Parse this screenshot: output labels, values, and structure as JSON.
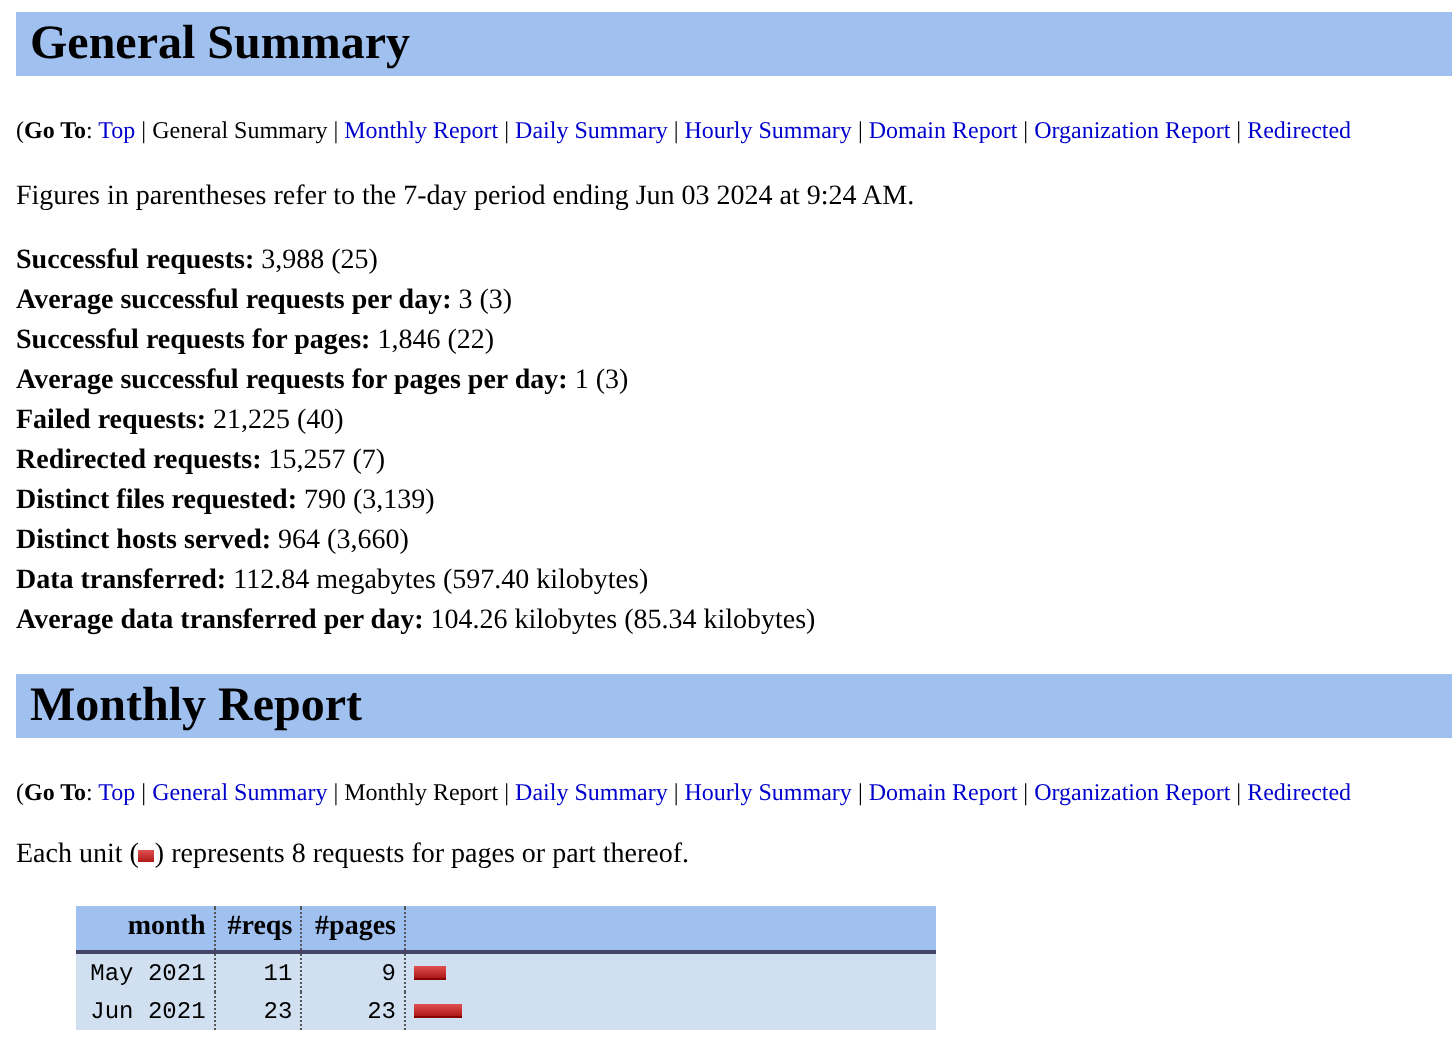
{
  "general_summary": {
    "title": "General Summary",
    "nav": {
      "label": "(**Go To**:",
      "separator": "|",
      "items": [
        {
          "text": "Top",
          "selected": false
        },
        {
          "text": "General Summary",
          "selected": true
        },
        {
          "text": "Monthly Report",
          "selected": false
        },
        {
          "text": "Daily Summary",
          "selected": false
        },
        {
          "text": "Hourly Summary",
          "selected": false
        },
        {
          "text": "Domain Report",
          "selected": false
        },
        {
          "text": "Organization Report",
          "selected": false
        },
        {
          "text": "Redirected",
          "selected": false
        }
      ]
    },
    "note": "Figures in parentheses refer to the 7-day period ending Jun 03 2024 at 9:24 AM.",
    "stats": [
      {
        "label": "Successful requests:",
        "value": "3,988 (25)"
      },
      {
        "label": "Average successful requests per day:",
        "value": "3 (3)"
      },
      {
        "label": "Successful requests for pages:",
        "value": "1,846 (22)"
      },
      {
        "label": "Average successful requests for pages per day:",
        "value": "1 (3)"
      },
      {
        "label": "Failed requests:",
        "value": "21,225 (40)"
      },
      {
        "label": "Redirected requests:",
        "value": "15,257 (7)"
      },
      {
        "label": "Distinct files requested:",
        "value": "790 (3,139)"
      },
      {
        "label": "Distinct hosts served:",
        "value": "964 (3,660)"
      },
      {
        "label": "Data transferred:",
        "value": "112.84 megabytes (597.40 kilobytes)"
      },
      {
        "label": "Average data transferred per day:",
        "value": "104.26 kilobytes (85.34 kilobytes)"
      }
    ]
  },
  "monthly_report": {
    "title": "Monthly Report",
    "nav": {
      "label": "(**Go To**:",
      "separator": "|",
      "items": [
        {
          "text": "Top",
          "selected": false
        },
        {
          "text": "General Summary",
          "selected": false
        },
        {
          "text": "Monthly Report",
          "selected": true
        },
        {
          "text": "Daily Summary",
          "selected": false
        },
        {
          "text": "Hourly Summary",
          "selected": false
        },
        {
          "text": "Domain Report",
          "selected": false
        },
        {
          "text": "Organization Report",
          "selected": false
        },
        {
          "text": "Redirected",
          "selected": false
        }
      ]
    },
    "note_before": "Each unit (",
    "note_after": ") represents 8 requests for pages or part thereof.",
    "table": {
      "columns": [
        "month",
        "#reqs",
        "#pages"
      ],
      "rows": [
        {
          "month": "May 2021",
          "reqs": "11",
          "pages": "9",
          "level": 0.062
        },
        {
          "month": "Jun 2021",
          "reqs": "23",
          "pages": "23",
          "level": 0.093
        }
      ]
    }
  }
}
